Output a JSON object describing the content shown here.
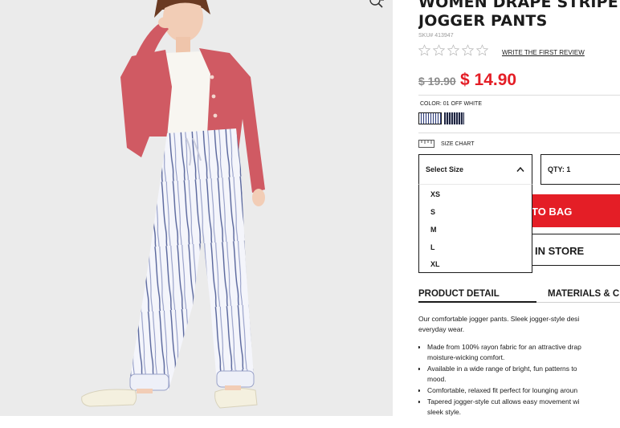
{
  "product": {
    "title": "WOMEN DRAPE STRIPE\nJOGGER PANTS",
    "sku": "SKU# 413947",
    "rating_stars": 0,
    "rating_max": 5,
    "review_link": "WRITE THE FIRST REVIEW",
    "price_original": "$ 19.90",
    "price_sale": "$ 14.90",
    "color_label": "COLOR: 01 OFF WHITE",
    "size_chart_label": "SIZE CHART",
    "size_select": {
      "label": "Select Size",
      "options": [
        "XS",
        "S",
        "M",
        "L",
        "XL"
      ]
    },
    "qty_label": "QTY: 1",
    "add_to_bag_label": "TO BAG",
    "find_in_store_label": "IN STORE"
  },
  "tabs": [
    {
      "label": "PRODUCT DETAIL"
    },
    {
      "label": "MATERIALS & C"
    }
  ],
  "description": {
    "intro_line1": "Our comfortable jogger pants. Sleek jogger-style desi",
    "intro_line2": "everyday wear.",
    "bullets": [
      {
        "line1": "Made from 100% rayon fabric for an attractive drap",
        "line2": "moisture-wicking comfort."
      },
      {
        "line1": "Available in a wide range of bright, fun patterns to",
        "line2": "mood."
      },
      {
        "line1": "Comfortable, relaxed fit perfect for lounging aroun",
        "line2": ""
      },
      {
        "line1": "Tapered jogger-style cut allows easy movement wi",
        "line2": "sleek style."
      }
    ]
  },
  "colors": {
    "accent_red": "#e41e26",
    "text": "#1b1b1b",
    "image_bg": "#ebebeb",
    "cardigan": "#d05a63",
    "pants_stripe": "#2f3e7a"
  },
  "icons": {
    "zoom": "zoom-icon",
    "star": "star-outline-icon",
    "ruler": "ruler-icon",
    "chevron": "chevron-up-icon"
  }
}
